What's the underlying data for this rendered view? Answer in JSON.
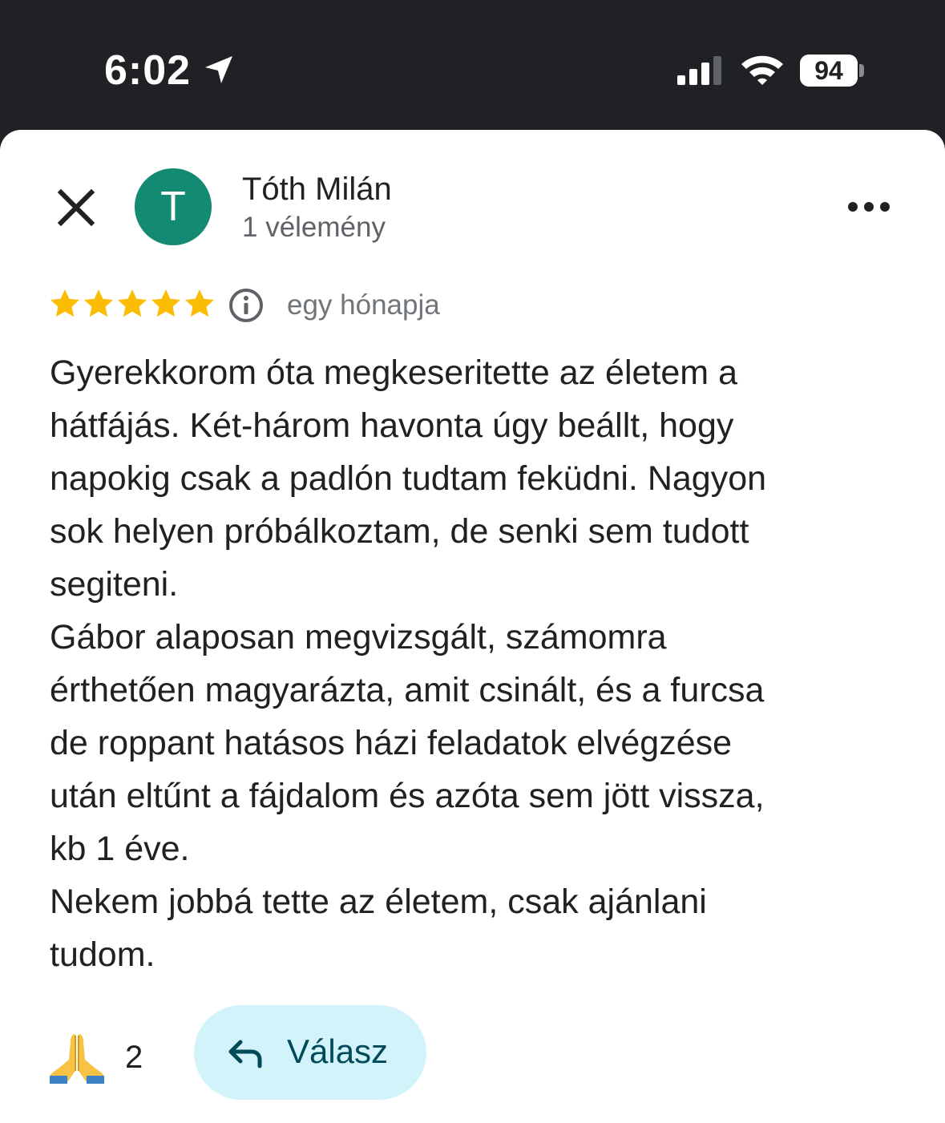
{
  "status_bar": {
    "time": "6:02",
    "battery_level": "94",
    "icons": [
      "location-arrow-icon",
      "cellular-signal-icon",
      "wifi-icon",
      "battery-icon"
    ]
  },
  "review": {
    "reviewer_name": "Tóth Milán",
    "avatar_letter": "T",
    "avatar_color": "#138a72",
    "review_count": "1 vélemény",
    "rating": 5,
    "rating_max": 5,
    "star_color": "#fbbc04",
    "date": "egy hónapja",
    "text_lines": [
      "Gyerekkorom óta megkeseritette az életem a",
      "hátfájás. Két-három havonta úgy beállt, hogy",
      "napokig csak a padlón tudtam feküdni. Nagyon",
      "sok helyen próbálkoztam, de senki sem tudott",
      "segiteni.",
      "Gábor alaposan megvizsgált, számomra",
      "érthetően magyarázta, amit csinált, és a furcsa",
      "de roppant hatásos házi feladatok elvégzése",
      "után eltűnt a fájdalom és azóta sem jött vissza,",
      "kb 1 éve.",
      "Nekem jobbá tette az életem, csak ajánlani",
      "tudom."
    ]
  },
  "reactions": {
    "emoji": "🙏",
    "count": "2"
  },
  "actions": {
    "reply_label": "Válasz",
    "reply_bg": "#d3f3fb"
  }
}
